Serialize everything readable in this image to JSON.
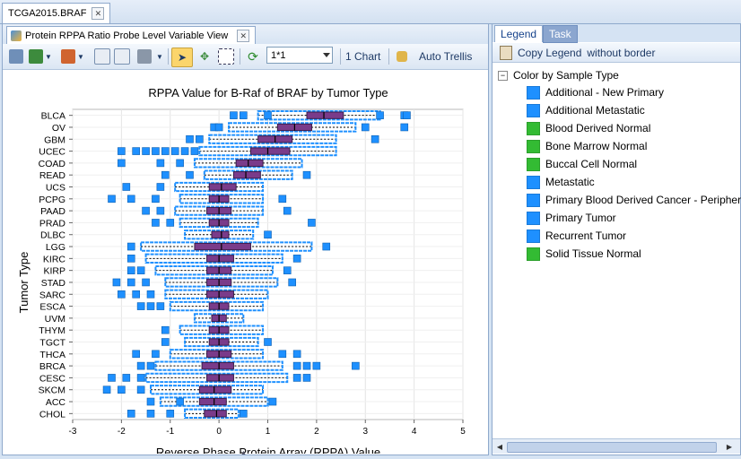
{
  "document_tab": {
    "label": "TCGA2015.BRAF"
  },
  "view_tab": {
    "label": "Protein RPPA Ratio Probe Level Variable View"
  },
  "toolbar": {
    "trellis_value": "1*1",
    "chart_count_label": "1 Chart",
    "auto_trellis_label": "Auto Trellis"
  },
  "right_panel": {
    "tabs": [
      "Legend",
      "Task"
    ],
    "copy_legend_label": "Copy Legend",
    "without_border_label": "without border",
    "legend_title": "Color by Sample Type",
    "items": [
      {
        "label": "Additional - New Primary",
        "color": "#1e90ff"
      },
      {
        "label": "Additional Metastatic",
        "color": "#1e90ff"
      },
      {
        "label": "Blood Derived Normal",
        "color": "#33bb33"
      },
      {
        "label": "Bone Marrow Normal",
        "color": "#33bb33"
      },
      {
        "label": "Buccal Cell Normal",
        "color": "#33bb33"
      },
      {
        "label": "Metastatic",
        "color": "#1e90ff"
      },
      {
        "label": "Primary Blood Derived Cancer - Peripheral Blo",
        "color": "#1e90ff"
      },
      {
        "label": "Primary Tumor",
        "color": "#1e90ff"
      },
      {
        "label": "Recurrent Tumor",
        "color": "#1e90ff"
      },
      {
        "label": "Solid Tissue Normal",
        "color": "#33bb33"
      }
    ]
  },
  "chart_data": {
    "type": "boxplot",
    "title": "RPPA Value for B-Raf of BRAF by Tumor Type",
    "xlabel": "Reverse Phase Protein Array (RPPA) Value",
    "ylabel": "Tumor Type",
    "xlim": [
      -3,
      5
    ],
    "xticks": [
      -3,
      -2,
      -1,
      0,
      1,
      2,
      3,
      4,
      5
    ],
    "grid": true,
    "orientation": "horizontal",
    "point_color": "#1e90ff",
    "box_color": "#7a3b8a",
    "categories": [
      "BLCA",
      "OV",
      "GBM",
      "UCEC",
      "COAD",
      "READ",
      "UCS",
      "PCPG",
      "PAAD",
      "PRAD",
      "DLBC",
      "LGG",
      "KIRC",
      "KIRP",
      "STAD",
      "SARC",
      "ESCA",
      "UVM",
      "THYM",
      "TGCT",
      "THCA",
      "BRCA",
      "CESC",
      "SKCM",
      "ACC",
      "CHOL"
    ],
    "boxes": [
      {
        "cat": "BLCA",
        "q1": 1.8,
        "med": 2.15,
        "q3": 2.55,
        "wlo": 0.8,
        "whi": 3.3
      },
      {
        "cat": "OV",
        "q1": 1.2,
        "med": 1.55,
        "q3": 1.9,
        "wlo": 0.2,
        "whi": 2.8
      },
      {
        "cat": "GBM",
        "q1": 0.8,
        "med": 1.15,
        "q3": 1.5,
        "wlo": -0.2,
        "whi": 2.4
      },
      {
        "cat": "UCEC",
        "q1": 0.65,
        "med": 1.0,
        "q3": 1.45,
        "wlo": -0.4,
        "whi": 2.4
      },
      {
        "cat": "COAD",
        "q1": 0.35,
        "med": 0.6,
        "q3": 0.9,
        "wlo": -0.5,
        "whi": 1.7
      },
      {
        "cat": "READ",
        "q1": 0.3,
        "med": 0.55,
        "q3": 0.85,
        "wlo": -0.3,
        "whi": 1.5
      },
      {
        "cat": "UCS",
        "q1": -0.2,
        "med": 0.05,
        "q3": 0.35,
        "wlo": -0.9,
        "whi": 0.9
      },
      {
        "cat": "PCPG",
        "q1": -0.2,
        "med": 0.0,
        "q3": 0.2,
        "wlo": -0.8,
        "whi": 0.9
      },
      {
        "cat": "PAAD",
        "q1": -0.25,
        "med": 0.0,
        "q3": 0.25,
        "wlo": -0.9,
        "whi": 0.9
      },
      {
        "cat": "PRAD",
        "q1": -0.2,
        "med": 0.0,
        "q3": 0.2,
        "wlo": -0.8,
        "whi": 0.8
      },
      {
        "cat": "DLBC",
        "q1": -0.15,
        "med": 0.05,
        "q3": 0.2,
        "wlo": -0.7,
        "whi": 0.7
      },
      {
        "cat": "LGG",
        "q1": -0.5,
        "med": 0.05,
        "q3": 0.65,
        "wlo": -1.6,
        "whi": 1.9
      },
      {
        "cat": "KIRC",
        "q1": -0.25,
        "med": 0.0,
        "q3": 0.3,
        "wlo": -1.5,
        "whi": 1.3
      },
      {
        "cat": "KIRP",
        "q1": -0.25,
        "med": 0.0,
        "q3": 0.25,
        "wlo": -1.3,
        "whi": 1.1
      },
      {
        "cat": "STAD",
        "q1": -0.25,
        "med": 0.0,
        "q3": 0.25,
        "wlo": -1.1,
        "whi": 1.2
      },
      {
        "cat": "SARC",
        "q1": -0.25,
        "med": 0.0,
        "q3": 0.3,
        "wlo": -1.1,
        "whi": 1.0
      },
      {
        "cat": "ESCA",
        "q1": -0.2,
        "med": 0.0,
        "q3": 0.2,
        "wlo": -1.0,
        "whi": 0.9
      },
      {
        "cat": "UVM",
        "q1": -0.15,
        "med": 0.0,
        "q3": 0.15,
        "wlo": -0.5,
        "whi": 0.5
      },
      {
        "cat": "THYM",
        "q1": -0.2,
        "med": 0.0,
        "q3": 0.2,
        "wlo": -0.8,
        "whi": 0.9
      },
      {
        "cat": "TGCT",
        "q1": -0.2,
        "med": 0.0,
        "q3": 0.2,
        "wlo": -0.7,
        "whi": 0.8
      },
      {
        "cat": "THCA",
        "q1": -0.25,
        "med": 0.0,
        "q3": 0.25,
        "wlo": -1.0,
        "whi": 0.9
      },
      {
        "cat": "BRCA",
        "q1": -0.35,
        "med": 0.0,
        "q3": 0.3,
        "wlo": -1.3,
        "whi": 1.3
      },
      {
        "cat": "CESC",
        "q1": -0.25,
        "med": 0.0,
        "q3": 0.3,
        "wlo": -1.5,
        "whi": 1.4
      },
      {
        "cat": "SKCM",
        "q1": -0.4,
        "med": -0.1,
        "q3": 0.25,
        "wlo": -1.4,
        "whi": 0.9
      },
      {
        "cat": "ACC",
        "q1": -0.4,
        "med": -0.1,
        "q3": 0.15,
        "wlo": -1.2,
        "whi": 1.0
      },
      {
        "cat": "CHOL",
        "q1": -0.3,
        "med": -0.05,
        "q3": 0.15,
        "wlo": -0.7,
        "whi": 0.4
      }
    ],
    "outliers": [
      {
        "cat": "BLCA",
        "values": [
          3.3,
          3.8,
          3.85,
          0.3,
          0.5,
          1.0
        ]
      },
      {
        "cat": "OV",
        "values": [
          -0.1,
          0.0,
          3.8,
          3.0
        ]
      },
      {
        "cat": "GBM",
        "values": [
          -0.6,
          -0.4,
          3.2
        ]
      },
      {
        "cat": "UCEC",
        "values": [
          -2.0,
          -1.7,
          -1.5,
          -1.3,
          -1.1,
          -0.9,
          -0.7,
          -0.5
        ]
      },
      {
        "cat": "COAD",
        "values": [
          -2.0,
          -1.2,
          -0.8
        ]
      },
      {
        "cat": "READ",
        "values": [
          -1.1,
          -0.6,
          1.8
        ]
      },
      {
        "cat": "UCS",
        "values": [
          -1.9,
          -1.2
        ]
      },
      {
        "cat": "PCPG",
        "values": [
          -2.2,
          -1.8,
          -1.3,
          1.3
        ]
      },
      {
        "cat": "PAAD",
        "values": [
          -1.5,
          -1.2,
          1.4
        ]
      },
      {
        "cat": "PRAD",
        "values": [
          -1.3,
          -1.0,
          1.9
        ]
      },
      {
        "cat": "DLBC",
        "values": [
          1.0
        ]
      },
      {
        "cat": "LGG",
        "values": [
          -1.8,
          2.2
        ]
      },
      {
        "cat": "KIRC",
        "values": [
          -1.8,
          1.6
        ]
      },
      {
        "cat": "KIRP",
        "values": [
          -1.8,
          -1.6,
          1.4
        ]
      },
      {
        "cat": "STAD",
        "values": [
          -2.1,
          -1.8,
          -1.5,
          1.5
        ]
      },
      {
        "cat": "SARC",
        "values": [
          -2.0,
          -1.7,
          -1.4
        ]
      },
      {
        "cat": "ESCA",
        "values": [
          -1.6,
          -1.4,
          -1.2
        ]
      },
      {
        "cat": "THYM",
        "values": [
          -1.1
        ]
      },
      {
        "cat": "TGCT",
        "values": [
          -1.1,
          1.0
        ]
      },
      {
        "cat": "THCA",
        "values": [
          -1.7,
          -1.3,
          1.3,
          1.6
        ]
      },
      {
        "cat": "BRCA",
        "values": [
          -1.6,
          -1.4,
          1.6,
          1.8,
          2.0,
          2.8
        ]
      },
      {
        "cat": "CESC",
        "values": [
          -2.2,
          -1.9,
          -1.6,
          1.6,
          1.8
        ]
      },
      {
        "cat": "SKCM",
        "values": [
          -2.3,
          -2.0,
          -1.6
        ]
      },
      {
        "cat": "ACC",
        "values": [
          -1.4,
          -0.8,
          1.1
        ]
      },
      {
        "cat": "CHOL",
        "values": [
          -1.8,
          -1.4,
          -1.0,
          0.5
        ]
      }
    ]
  }
}
